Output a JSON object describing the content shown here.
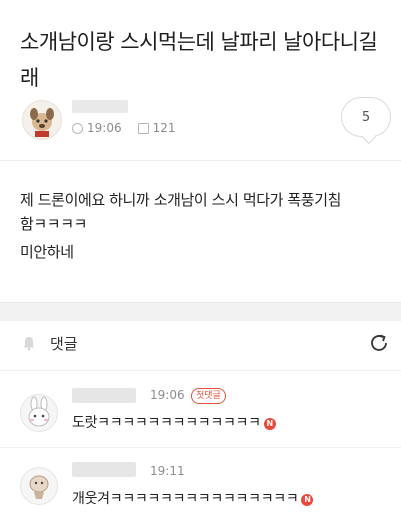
{
  "post": {
    "title": "소개남이랑 스시먹는데 날파리 날아다니길래",
    "time": "19:06",
    "views": "121",
    "comment_count": "5",
    "body_line1": "제 드론이에요 하니까 소개남이 스시 먹다가 폭풍기침",
    "body_line2": "함ㅋㅋㅋㅋ",
    "body_line3": "미안하네"
  },
  "comments_section": {
    "title": "댓글"
  },
  "comments": [
    {
      "time": "19:06",
      "badge": "첫댓글",
      "text": "도랏ㅋㅋㅋㅋㅋㅋㅋㅋㅋㅋㅋㅋㅋ",
      "new_mark": "N"
    },
    {
      "time": "19:11",
      "text": "개웃겨ㅋㅋㅋㅋㅋㅋㅋㅋㅋㅋㅋㅋㅋㅋㅋ",
      "new_mark": "N"
    }
  ],
  "icons": {
    "clock": "clock-icon",
    "views": "views-icon",
    "bell": "bell-icon",
    "refresh": "refresh-icon",
    "new": "new-badge-icon"
  },
  "colors": {
    "accent_pink": "#f3c3d5",
    "badge_red": "#e5533d",
    "new_red": "#e64a3b"
  }
}
